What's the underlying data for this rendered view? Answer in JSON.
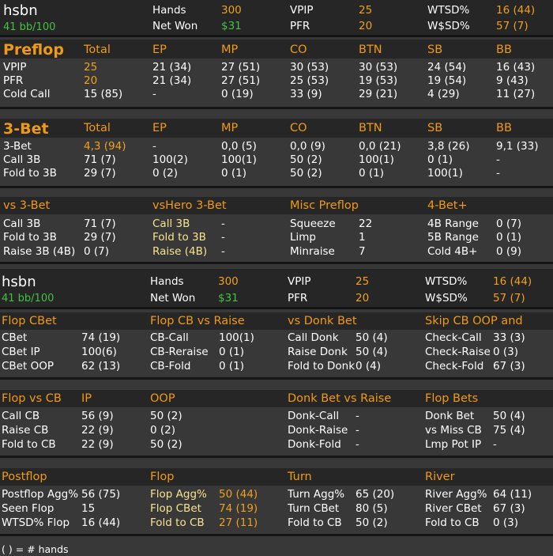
{
  "player": {
    "name": "hsbn",
    "bb100": "41 bb/100"
  },
  "summary": {
    "hands_label": "Hands",
    "hands": "300",
    "netwon_label": "Net Won",
    "netwon": "$31",
    "vpip_label": "VPIP",
    "vpip": "25",
    "pfr_label": "PFR",
    "pfr": "20",
    "wtsd_label": "WTSD%",
    "wtsd": "16 (44)",
    "wssd_label": "W$SD%",
    "wssd": "57 (7)"
  },
  "preflop": {
    "title": "Preflop",
    "cols": [
      "Total",
      "EP",
      "MP",
      "CO",
      "BTN",
      "SB",
      "BB"
    ],
    "rows": [
      {
        "label": "VPIP",
        "vals": [
          "25",
          "21 (34)",
          "27 (51)",
          "30 (53)",
          "30 (53)",
          "24 (54)",
          "16 (43)"
        ]
      },
      {
        "label": "PFR",
        "vals": [
          "20",
          "21 (34)",
          "27 (51)",
          "25 (53)",
          "19 (53)",
          "19 (54)",
          "9 (43)"
        ]
      },
      {
        "label": "Cold Call",
        "vals": [
          "15 (85)",
          "-",
          "0 (19)",
          "33 (9)",
          "29 (21)",
          "4 (29)",
          "11 (27)"
        ]
      }
    ]
  },
  "threebet": {
    "title": "3-Bet",
    "cols": [
      "Total",
      "EP",
      "MP",
      "CO",
      "BTN",
      "SB",
      "BB"
    ],
    "rows": [
      {
        "label": "3-Bet",
        "vals": [
          "4,3 (94)",
          "-",
          "0,0 (5)",
          "0,0 (9)",
          "0,0 (21)",
          "3,8 (26)",
          "9,1 (33)"
        ]
      },
      {
        "label": "Call 3B",
        "vals": [
          "71 (7)",
          "100(2)",
          "100(1)",
          "50 (2)",
          "100(1)",
          "0 (1)",
          "-"
        ]
      },
      {
        "label": "Fold to 3B",
        "vals": [
          "29 (7)",
          "0 (2)",
          "0 (1)",
          "50 (2)",
          "0 (1)",
          "100(1)",
          "-"
        ]
      }
    ]
  },
  "vs3bet": {
    "headers": [
      "vs 3-Bet",
      "vsHero 3-Bet",
      "Misc Preflop",
      "4-Bet+"
    ],
    "c1": [
      [
        "Call 3B",
        "71 (7)"
      ],
      [
        "Fold to 3B",
        "29 (7)"
      ],
      [
        "Raise 3B (4B)",
        "0 (7)"
      ]
    ],
    "c2": [
      [
        "Call 3B",
        "-"
      ],
      [
        "Fold to 3B",
        "-"
      ],
      [
        "Raise (4B)",
        "-"
      ]
    ],
    "c3": [
      [
        "Squeeze",
        "22"
      ],
      [
        "Limp",
        "1"
      ],
      [
        "Minraise",
        "7"
      ]
    ],
    "c4": [
      [
        "4B Range",
        "0 (7)"
      ],
      [
        "5B Range",
        "0 (1)"
      ],
      [
        "Cold 4B+",
        "0 (9)"
      ]
    ]
  },
  "postflop_block1": {
    "headers": [
      "Flop CBet",
      "Flop CB vs Raise",
      "vs Donk Bet",
      "Skip CB OOP and"
    ],
    "c1": [
      [
        "CBet",
        "74 (19)"
      ],
      [
        "CBet IP",
        "100(6)"
      ],
      [
        "CBet OOP",
        "62 (13)"
      ]
    ],
    "c2": [
      [
        "CB-Call",
        "100(1)"
      ],
      [
        "CB-Reraise",
        "0 (1)"
      ],
      [
        "CB-Fold",
        "0 (1)"
      ]
    ],
    "c3": [
      [
        "Call Donk",
        "50 (4)"
      ],
      [
        "Raise Donk",
        "50 (4)"
      ],
      [
        "Fold to Donk",
        "0 (4)"
      ]
    ],
    "c4": [
      [
        "Check-Call",
        "33 (3)"
      ],
      [
        "Check-Raise",
        "0 (3)"
      ],
      [
        "Check-Fold",
        "67 (3)"
      ]
    ]
  },
  "postflop_block2": {
    "headers": [
      "Flop vs CB",
      "IP",
      "OOP",
      "Donk Bet vs Raise",
      "Flop Bets"
    ],
    "c1": [
      [
        "Call CB",
        "56 (9)"
      ],
      [
        "Raise CB",
        "22 (9)"
      ],
      [
        "Fold to CB",
        "22 (9)"
      ]
    ],
    "c2": [
      "50 (2)",
      "0 (2)",
      "50 (2)"
    ],
    "c3": [
      [
        "Donk-Call",
        "-"
      ],
      [
        "Donk-Raise",
        "-"
      ],
      [
        "Donk-Fold",
        "-"
      ]
    ],
    "c4": [
      [
        "Donk Bet",
        "50 (4)"
      ],
      [
        "vs Miss CB",
        "75 (4)"
      ],
      [
        "Lmp Pot IP",
        "-"
      ]
    ]
  },
  "postflop_block3": {
    "headers": [
      "Postflop",
      "Flop",
      "Turn",
      "River"
    ],
    "c1": [
      [
        "Postflop Agg%",
        "56 (75)"
      ],
      [
        "Seen Flop",
        "15"
      ],
      [
        "WTSD% Flop",
        "16 (44)"
      ]
    ],
    "c2": [
      [
        "Flop Agg%",
        "50 (44)"
      ],
      [
        "Flop CBet",
        "74 (19)"
      ],
      [
        "Fold to CB",
        "27 (11)"
      ]
    ],
    "c3": [
      [
        "Turn Agg%",
        "65 (20)"
      ],
      [
        "Turn CBet",
        "80 (5)"
      ],
      [
        "Fold to CB",
        "50 (2)"
      ]
    ],
    "c4": [
      [
        "River Agg%",
        "64 (11)"
      ],
      [
        "River CBet",
        "67 (3)"
      ],
      [
        "Fold to CB",
        "0 (3)"
      ]
    ]
  },
  "footer": {
    "note": "( ) = # hands"
  },
  "colors": {
    "bg": "#383838",
    "header_bg": "#262626",
    "accent": "#f09a14",
    "value_orange": "#f0a01d",
    "hero_yellow": "#f7e38e",
    "money_green": "#42c242"
  }
}
